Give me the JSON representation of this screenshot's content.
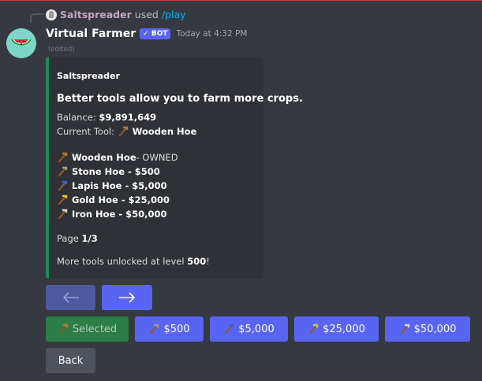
{
  "reply": {
    "username": "Saltspreader",
    "used_text": "used",
    "command": "/play"
  },
  "message": {
    "bot_name": "Virtual Farmer",
    "badge": "✓ BOT",
    "timestamp": "Today at 4:32 PM",
    "edited": "(edited)"
  },
  "embed": {
    "author": "Saltspreader",
    "title": "Better tools allow you to farm more crops.",
    "balance_label": "Balance:",
    "balance_value": "$9,891,649",
    "current_tool_label": "Current Tool:",
    "current_tool_value": "Wooden Hoe",
    "tools": [
      {
        "name": "Wooden Hoe",
        "suffix": " - OWNED",
        "icon": "wooden-hoe-icon",
        "color": "#b07a3a"
      },
      {
        "name": "Stone Hoe - $500",
        "suffix": "",
        "icon": "stone-hoe-icon",
        "color": "#9b9b9b"
      },
      {
        "name": "Lapis Hoe - $5,000",
        "suffix": "",
        "icon": "lapis-hoe-icon",
        "color": "#3c5fd1"
      },
      {
        "name": "Gold Hoe - $25,000",
        "suffix": "",
        "icon": "gold-hoe-icon",
        "color": "#e8c13a"
      },
      {
        "name": "Iron Hoe - $50,000",
        "suffix": "",
        "icon": "iron-hoe-icon",
        "color": "#d8d8d8"
      }
    ],
    "page_label": "Page",
    "page_value": "1/3",
    "unlock_prefix": "More tools unlocked at level",
    "unlock_level": "500",
    "unlock_suffix": "!"
  },
  "buttons": {
    "prev": "←",
    "next": "→",
    "selected": "Selected",
    "price_500": "$500",
    "price_5000": "$5,000",
    "price_25000": "$25,000",
    "price_50000": "$50,000",
    "back": "Back"
  },
  "colors": {
    "accent": "#5865f2",
    "embed_border": "#1f8b5a",
    "success": "#2d7d46",
    "background": "#36393f"
  }
}
